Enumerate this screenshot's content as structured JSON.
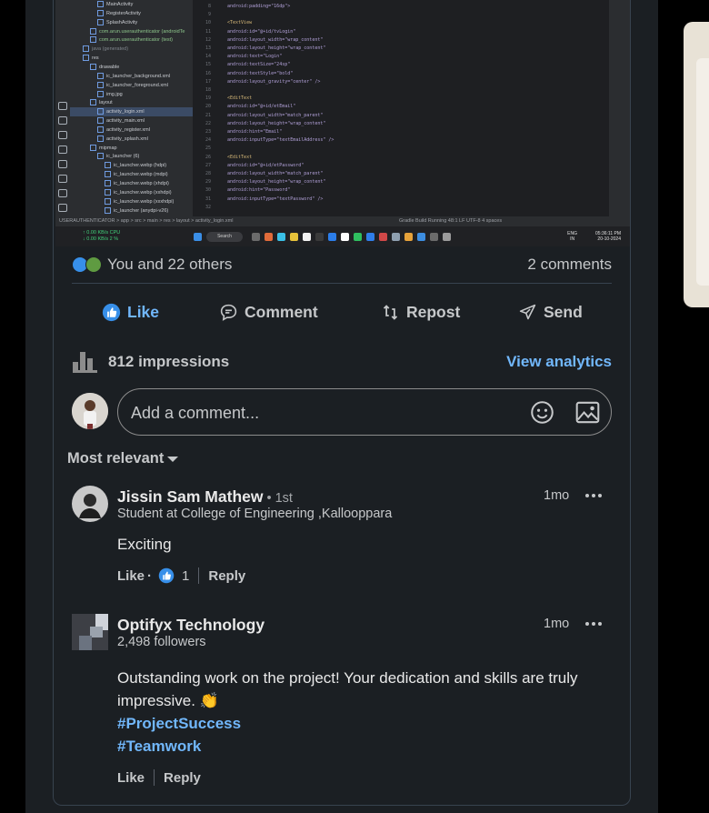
{
  "ide": {
    "tree_items": [
      {
        "label": "MainActivity",
        "indent": 3,
        "kind": "file"
      },
      {
        "label": "RegisterActivity",
        "indent": 3,
        "kind": "file"
      },
      {
        "label": "SplashActivity",
        "indent": 3,
        "kind": "file"
      },
      {
        "label": "com.arun.userauthenticator (androidTe",
        "indent": 2,
        "kind": "green"
      },
      {
        "label": "com.arun.userauthenticator (test)",
        "indent": 2,
        "kind": "green"
      },
      {
        "label": "java (generated)",
        "indent": 1,
        "kind": "dim"
      },
      {
        "label": "res",
        "indent": 1,
        "kind": "folder"
      },
      {
        "label": "drawable",
        "indent": 2,
        "kind": "folder"
      },
      {
        "label": "ic_launcher_background.xml",
        "indent": 3,
        "kind": "file"
      },
      {
        "label": "ic_launcher_foreground.xml",
        "indent": 3,
        "kind": "file"
      },
      {
        "label": "img.jpg",
        "indent": 3,
        "kind": "file"
      },
      {
        "label": "layout",
        "indent": 2,
        "kind": "folder"
      },
      {
        "label": "activity_login.xml",
        "indent": 3,
        "kind": "selected"
      },
      {
        "label": "activity_main.xml",
        "indent": 3,
        "kind": "file"
      },
      {
        "label": "activity_register.xml",
        "indent": 3,
        "kind": "file"
      },
      {
        "label": "activity_splash.xml",
        "indent": 3,
        "kind": "file"
      },
      {
        "label": "mipmap",
        "indent": 2,
        "kind": "folder"
      },
      {
        "label": "ic_launcher (6)",
        "indent": 3,
        "kind": "folder"
      },
      {
        "label": "ic_launcher.webp (hdpi)",
        "indent": 4,
        "kind": "file"
      },
      {
        "label": "ic_launcher.webp (mdpi)",
        "indent": 4,
        "kind": "file"
      },
      {
        "label": "ic_launcher.webp (xhdpi)",
        "indent": 4,
        "kind": "file"
      },
      {
        "label": "ic_launcher.webp (xxhdpi)",
        "indent": 4,
        "kind": "file"
      },
      {
        "label": "ic_launcher.webp (xxxhdpi)",
        "indent": 4,
        "kind": "file"
      },
      {
        "label": "ic_launcher (anydpi-v26)",
        "indent": 4,
        "kind": "file"
      }
    ],
    "code_lines": [
      {
        "num": "8",
        "text": "android:padding=\"16dp\">",
        "kind": "attr"
      },
      {
        "num": "9",
        "text": "",
        "kind": "plain"
      },
      {
        "num": "10",
        "text": "<TextView",
        "kind": "tag"
      },
      {
        "num": "11",
        "text": "    android:id=\"@+id/tvLogin\"",
        "kind": "attr"
      },
      {
        "num": "12",
        "text": "    android:layout_width=\"wrap_content\"",
        "kind": "attr"
      },
      {
        "num": "13",
        "text": "    android:layout_height=\"wrap_content\"",
        "kind": "attr"
      },
      {
        "num": "14",
        "text": "    android:text=\"Login\"",
        "kind": "attr"
      },
      {
        "num": "15",
        "text": "    android:textSize=\"24sp\"",
        "kind": "attr"
      },
      {
        "num": "16",
        "text": "    android:textStyle=\"bold\"",
        "kind": "attr"
      },
      {
        "num": "17",
        "text": "    android:layout_gravity=\"center\" />",
        "kind": "attr"
      },
      {
        "num": "18",
        "text": "",
        "kind": "plain"
      },
      {
        "num": "19",
        "text": "<EditText",
        "kind": "tag"
      },
      {
        "num": "20",
        "text": "    android:id=\"@+id/etEmail\"",
        "kind": "attr"
      },
      {
        "num": "21",
        "text": "    android:layout_width=\"match_parent\"",
        "kind": "attr"
      },
      {
        "num": "22",
        "text": "    android:layout_height=\"wrap_content\"",
        "kind": "attr"
      },
      {
        "num": "23",
        "text": "    android:hint=\"Email\"",
        "kind": "attr"
      },
      {
        "num": "24",
        "text": "    android:inputType=\"textEmailAddress\" />",
        "kind": "attr"
      },
      {
        "num": "25",
        "text": "",
        "kind": "plain"
      },
      {
        "num": "26",
        "text": "<EditText",
        "kind": "tag"
      },
      {
        "num": "27",
        "text": "    android:id=\"@+id/etPassword\"",
        "kind": "attr"
      },
      {
        "num": "28",
        "text": "    android:layout_width=\"match_parent\"",
        "kind": "attr"
      },
      {
        "num": "29",
        "text": "    android:layout_height=\"wrap_content\"",
        "kind": "attr"
      },
      {
        "num": "30",
        "text": "    android:hint=\"Password\"",
        "kind": "attr"
      },
      {
        "num": "31",
        "text": "    android:inputType=\"textPassword\" />",
        "kind": "attr"
      },
      {
        "num": "32",
        "text": "",
        "kind": "plain"
      }
    ],
    "status_left": "USERAUTHENTICATOR > app > src > main > res > layout > activity_login.xml",
    "status_right": "Gradle Build Running   48:1  LF  UTF-8  4 spaces",
    "net_up": "0.00 KB/s",
    "net_down": "0.00 KB/s",
    "cpu_label": "CPU",
    "cpu_value": "2 %",
    "search_label": "Search",
    "lang_top": "ENG",
    "lang_bottom": "IN",
    "clock_time": "05:36:11 PM",
    "clock_date": "20-10-2024"
  },
  "social": {
    "reactions_text": "You and 22 others",
    "comments_count": "2 comments",
    "reaction_colors": [
      "#378fe9",
      "#5f9b41"
    ]
  },
  "actions": {
    "like": "Like",
    "comment": "Comment",
    "repost": "Repost",
    "send": "Send",
    "like_active_color": "#71b7fb"
  },
  "analytics": {
    "impressions": "812 impressions",
    "view_link": "View analytics"
  },
  "comment_input": {
    "placeholder": "Add a comment..."
  },
  "sort": {
    "label": "Most relevant"
  },
  "comments": [
    {
      "name": "Jissin Sam Mathew",
      "degree": "• 1st",
      "headline": "Student at College of Engineering ,Kallooppara",
      "time": "1mo",
      "text": "Exciting",
      "like_label": "Like",
      "dot": "·",
      "reaction_count": "1",
      "reply_label": "Reply"
    },
    {
      "name": "Optifyx Technology",
      "headline": "2,498 followers",
      "time": "1mo",
      "text": "Outstanding work on the project! Your dedication and skills are truly impressive. 👏",
      "hashtags": [
        "#ProjectSuccess",
        "#Teamwork"
      ],
      "like_label": "Like",
      "reply_label": "Reply"
    }
  ]
}
